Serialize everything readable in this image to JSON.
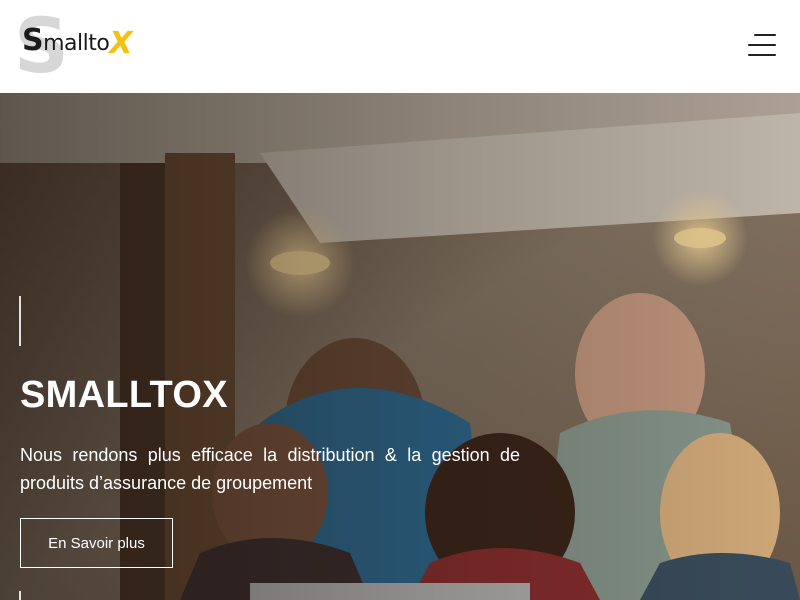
{
  "header": {
    "logo": {
      "initial": "S",
      "text": "mallto",
      "accent_letter": "X",
      "accent_color": "#f3c111"
    },
    "menu_icon": "hamburger-menu-icon"
  },
  "hero": {
    "title": "SMALLTOX",
    "subtitle": "Nous rendons plus efficace la distribution & la gestion de produits d’assurance de groupement",
    "button_label": "En Savoir plus"
  }
}
